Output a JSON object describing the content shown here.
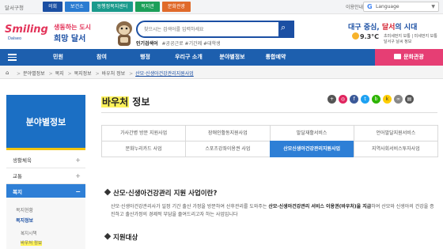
{
  "topbar": {
    "home": "달서구청",
    "tabs": [
      "의회",
      "보건소",
      "동행정복지센터",
      "복지관",
      "문화관광"
    ],
    "right_label": "이용안내",
    "google_label": "Google",
    "google_sub": "Language"
  },
  "header": {
    "logo_en": "Smiling",
    "logo_city": "Dalseo",
    "logo_kr_1": "생동하는 도시",
    "logo_kr_2": "희망 달서",
    "search_placeholder": "찾으시는 검색어를 입력하세요",
    "popular_label": "인기검색어",
    "popular_terms": "#공공근로  #기간제  #대학생",
    "slogan_pre": "대구 중심, ",
    "slogan_accent": "달서",
    "slogan_post": "의 시대",
    "temperature": "9.3°C",
    "weather_loc_1": "초미세먼지 보통 | 미세먼지 보통",
    "weather_loc_2": "달서구 날씨 정보"
  },
  "nav": {
    "items": [
      "민원",
      "참여",
      "행정",
      "우리구 소개",
      "분야별정보",
      "통합예약"
    ],
    "culture": "문화관광"
  },
  "breadcrumb": {
    "items": [
      "분야별정보",
      "복지",
      "복지정보",
      "바우처 정보"
    ],
    "current": "산모·신생아건강관리지원사업"
  },
  "sidebar": {
    "title": "분야별정보",
    "items": [
      {
        "label": "생활체육"
      },
      {
        "label": "교통"
      },
      {
        "label": "복지"
      }
    ],
    "subs": [
      "복지현황",
      "복지정보"
    ],
    "subsubs": [
      "복지시책",
      "바우처 정보"
    ]
  },
  "content": {
    "heading_mark": "바우처",
    "heading_rest": " 정보",
    "tabs": [
      "가사간병 방문 지원사업",
      "장애인활동지원사업",
      "발달재활서비스",
      "언어발달지원서비스",
      "문화누리카드 사업",
      "스포츠강좌이용권 사업",
      "산모신생아건강관리지원사업",
      "지역사회서비스투자사업"
    ],
    "active_tab": 6,
    "section1_title": "산모·신생아건강관리 지원 사업이란?",
    "para_1": "산모·신생아건강관리사가 일정 기간 출산 가정을 방문하여 산후관리를 도와주는 ",
    "para_bold": "산모·신생아건강관리 서비스 이용권(바우처)을 지급",
    "para_2": "하여 산모와 신생아의 건강을 증진하고 출산가정의 경제적 부담을 줄여드리고자 하는 사업입니다",
    "section2_title": "지원대상"
  },
  "colors": {
    "brand_blue": "#1d5fae",
    "active_blue": "#2e7fd6",
    "culture_pink": "#e63e74",
    "highlight": "#fff35a"
  }
}
